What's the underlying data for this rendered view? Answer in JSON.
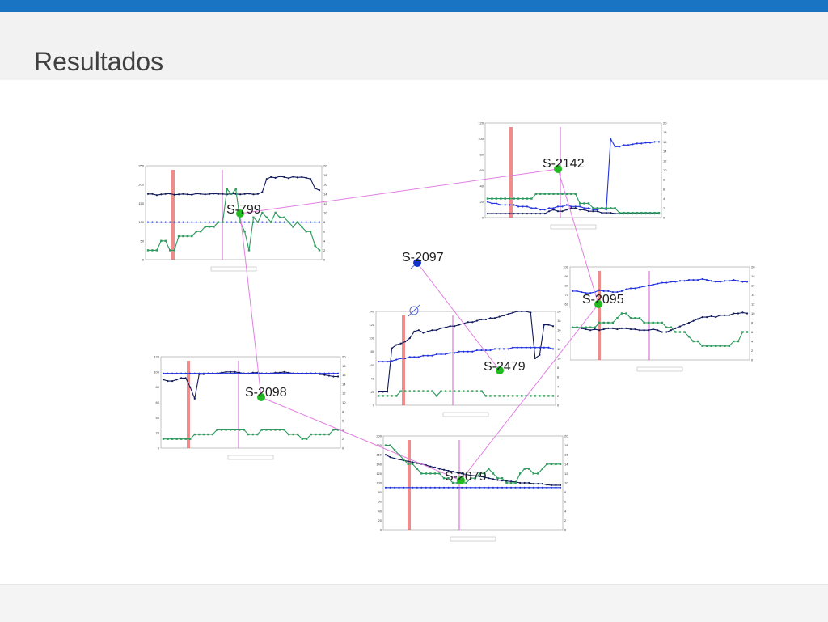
{
  "slide": {
    "title": "Resultados"
  },
  "colors": {
    "accent_bar": "#1a74c4",
    "oil": "#101a5a",
    "water_pct": "#2233dd",
    "pressure": "#2e9a5e",
    "event_red": "#e23030",
    "event_pink": "#d86ad8",
    "link": "#e27ee2",
    "producer": "#22bb22",
    "injector": "#1133cc"
  },
  "wells": [
    {
      "name": "S-799",
      "kind": "producer"
    },
    {
      "name": "S-2142",
      "kind": "producer"
    },
    {
      "name": "S-2097",
      "kind": "injector"
    },
    {
      "name": "S-2095",
      "kind": "producer"
    },
    {
      "name": "S-2479",
      "kind": "producer"
    },
    {
      "name": "S-2098",
      "kind": "producer"
    },
    {
      "name": "S-2079",
      "kind": "producer"
    }
  ],
  "links": [
    [
      "S-799",
      "S-2142"
    ],
    [
      "S-2142",
      "S-2095"
    ],
    [
      "S-799",
      "S-2098"
    ],
    [
      "S-2098",
      "S-2079"
    ],
    [
      "S-2079",
      "S-2095"
    ],
    [
      "S-2097",
      "S-2479"
    ]
  ],
  "chart_data": [
    {
      "type": "line",
      "well": "S-799",
      "ylim": [
        0,
        250
      ],
      "y2lim": [
        0,
        20
      ],
      "yticks": [
        "250",
        "200",
        "150",
        "100",
        "50",
        "0"
      ],
      "y2ticks": [
        "20",
        "18",
        "16",
        "14",
        "12",
        "10",
        "8",
        "6",
        "4",
        "2",
        "0"
      ],
      "series": [
        {
          "axis": "left",
          "color": "oil",
          "values": [
            175,
            175,
            172,
            174,
            175,
            176,
            173,
            174,
            175,
            174,
            173,
            176,
            175,
            174,
            175,
            176,
            175,
            175,
            174,
            176,
            175,
            174,
            175,
            176,
            174,
            175,
            180,
            215,
            220,
            218,
            222,
            220,
            217,
            221,
            219,
            220,
            218,
            215,
            190,
            185
          ]
        },
        {
          "axis": "left",
          "color": "water_pct",
          "values": [
            100,
            100,
            100,
            100,
            100,
            100,
            100,
            100,
            100,
            100,
            100,
            100,
            100,
            100,
            100,
            100,
            100,
            100,
            100,
            100,
            100,
            100,
            100,
            100,
            100,
            100,
            100,
            100,
            100,
            100,
            100,
            100,
            100,
            100,
            100,
            100,
            100,
            100,
            100,
            100
          ]
        },
        {
          "axis": "right",
          "color": "pressure",
          "values": [
            2,
            2,
            2,
            4,
            4,
            2,
            2,
            5,
            5,
            5,
            5,
            6,
            6,
            7,
            7,
            7,
            8,
            8,
            15,
            14,
            15,
            8,
            6,
            2,
            9,
            8,
            10,
            9,
            8,
            10,
            9,
            9,
            8,
            7,
            8,
            7,
            6,
            6,
            3,
            2
          ]
        }
      ]
    },
    {
      "type": "line",
      "well": "S-2142",
      "ylim": [
        0,
        120
      ],
      "y2lim": [
        0,
        20
      ],
      "yticks": [
        "120",
        "100",
        "80",
        "60",
        "40",
        "20",
        "0"
      ],
      "y2ticks": [
        "20",
        "18",
        "16",
        "14",
        "12",
        "10",
        "8",
        "6",
        "4",
        "2",
        "0"
      ],
      "series": [
        {
          "axis": "left",
          "color": "oil",
          "values": [
            5,
            5,
            5,
            5,
            5,
            5,
            5,
            5,
            5,
            5,
            5,
            5,
            5,
            5,
            8,
            10,
            8,
            8,
            10,
            12,
            12,
            10,
            10,
            8,
            8,
            8,
            6,
            6,
            6,
            5,
            5,
            5,
            5,
            5,
            5,
            5,
            5,
            5,
            5,
            5
          ]
        },
        {
          "axis": "left",
          "color": "water_pct",
          "values": [
            20,
            18,
            18,
            16,
            16,
            16,
            16,
            14,
            14,
            14,
            12,
            12,
            10,
            10,
            12,
            12,
            14,
            14,
            16,
            14,
            14,
            14,
            12,
            12,
            10,
            10,
            12,
            10,
            100,
            90,
            90,
            92,
            92,
            93,
            94,
            94,
            95,
            95,
            96,
            96
          ]
        },
        {
          "axis": "right",
          "color": "pressure",
          "values": [
            4,
            4,
            4,
            4,
            4,
            4,
            4,
            4,
            4,
            4,
            4,
            5,
            5,
            5,
            5,
            5,
            5,
            5,
            5,
            5,
            5,
            3,
            3,
            3,
            2,
            2,
            2,
            2,
            2,
            2,
            1,
            1,
            1,
            1,
            1,
            1,
            1,
            1,
            1,
            1
          ]
        }
      ]
    },
    {
      "type": "line",
      "well": "S-2095",
      "ylim": [
        0,
        100
      ],
      "y2lim": [
        0,
        20
      ],
      "yticks": [
        "100",
        "90",
        "80",
        "70",
        "60",
        "50",
        "40",
        "30",
        "20",
        "10",
        "0"
      ],
      "y2ticks": [
        "20",
        "18",
        "16",
        "14",
        "12",
        "10",
        "8",
        "6",
        "4",
        "2",
        "0"
      ],
      "series": [
        {
          "axis": "left",
          "color": "oil",
          "values": [
            35,
            35,
            34,
            33,
            32,
            33,
            32,
            33,
            34,
            34,
            33,
            34,
            34,
            33,
            33,
            32,
            32,
            32,
            33,
            32,
            30,
            30,
            32,
            34,
            36,
            38,
            40,
            42,
            44,
            46,
            46,
            47,
            46,
            48,
            48,
            48,
            50,
            50,
            51,
            50
          ]
        },
        {
          "axis": "left",
          "color": "water_pct",
          "values": [
            74,
            74,
            73,
            72,
            72,
            73,
            75,
            74,
            74,
            73,
            73,
            74,
            76,
            77,
            77,
            78,
            79,
            80,
            81,
            82,
            83,
            83,
            84,
            84,
            85,
            85,
            86,
            86,
            86,
            87,
            86,
            85,
            84,
            84,
            85,
            85,
            86,
            85,
            84,
            84
          ]
        },
        {
          "axis": "right",
          "color": "pressure",
          "values": [
            7,
            7,
            7,
            7,
            7,
            7,
            8,
            8,
            8,
            8,
            9,
            10,
            10,
            9,
            9,
            9,
            8,
            8,
            8,
            8,
            8,
            7,
            7,
            6,
            6,
            6,
            5,
            4,
            4,
            3,
            3,
            3,
            3,
            3,
            3,
            3,
            4,
            4,
            6,
            6
          ]
        }
      ]
    },
    {
      "type": "line",
      "well": "S-2479",
      "ylim": [
        0,
        140
      ],
      "y2lim": [
        0,
        20
      ],
      "yticks": [
        "140",
        "120",
        "100",
        "80",
        "60",
        "40",
        "20",
        "0"
      ],
      "y2ticks": [
        "20",
        "18",
        "16",
        "14",
        "12",
        "10",
        "8",
        "6",
        "4",
        "2",
        "0"
      ],
      "series": [
        {
          "axis": "left",
          "color": "oil",
          "values": [
            20,
            20,
            20,
            85,
            90,
            92,
            95,
            100,
            110,
            112,
            108,
            110,
            112,
            112,
            115,
            116,
            118,
            118,
            120,
            122,
            124,
            124,
            126,
            128,
            128,
            130,
            130,
            132,
            134,
            136,
            138,
            140,
            140,
            140,
            138,
            70,
            75,
            120,
            120,
            118
          ]
        },
        {
          "axis": "left",
          "color": "water_pct",
          "values": [
            65,
            65,
            65,
            66,
            68,
            70,
            70,
            72,
            72,
            72,
            74,
            74,
            74,
            76,
            76,
            76,
            78,
            78,
            80,
            80,
            80,
            80,
            82,
            82,
            82,
            82,
            84,
            84,
            84,
            84,
            86,
            86,
            86,
            86,
            86,
            86,
            86,
            86,
            86,
            84
          ]
        },
        {
          "axis": "right",
          "color": "pressure",
          "values": [
            2,
            2,
            2,
            2,
            2,
            3,
            3,
            3,
            3,
            3,
            3,
            3,
            3,
            2,
            3,
            3,
            3,
            3,
            3,
            3,
            3,
            3,
            3,
            3,
            2,
            2,
            2,
            2,
            2,
            2,
            2,
            2,
            2,
            2,
            2,
            2,
            2,
            2,
            2,
            2
          ]
        }
      ]
    },
    {
      "type": "line",
      "well": "S-2098",
      "ylim": [
        0,
        120
      ],
      "y2lim": [
        0,
        20
      ],
      "yticks": [
        "120",
        "100",
        "80",
        "60",
        "40",
        "20",
        "0"
      ],
      "y2ticks": [
        "20",
        "18",
        "16",
        "14",
        "12",
        "10",
        "8",
        "6",
        "4",
        "2",
        "0"
      ],
      "series": [
        {
          "axis": "left",
          "color": "oil",
          "values": [
            90,
            88,
            88,
            90,
            92,
            92,
            80,
            65,
            97,
            97,
            98,
            98,
            98,
            99,
            100,
            100,
            100,
            99,
            98,
            98,
            99,
            99,
            98,
            98,
            98,
            99,
            99,
            100,
            99,
            98,
            98,
            98,
            98,
            98,
            98,
            97,
            96,
            95,
            94,
            94
          ]
        },
        {
          "axis": "left",
          "color": "water_pct",
          "values": [
            98,
            98,
            98,
            98,
            98,
            98,
            98,
            98,
            98,
            98,
            98,
            98,
            98,
            98,
            98,
            98,
            98,
            98,
            98,
            98,
            98,
            98,
            98,
            98,
            98,
            98,
            98,
            98,
            98,
            98,
            98,
            98,
            98,
            98,
            98,
            98,
            98,
            98,
            98,
            98
          ]
        },
        {
          "axis": "right",
          "color": "pressure",
          "values": [
            2,
            2,
            2,
            2,
            2,
            2,
            2,
            3,
            3,
            3,
            3,
            3,
            4,
            4,
            4,
            4,
            4,
            4,
            4,
            3,
            3,
            3,
            4,
            4,
            4,
            4,
            4,
            4,
            3,
            3,
            3,
            2,
            2,
            3,
            3,
            3,
            3,
            3,
            4,
            4
          ]
        }
      ]
    },
    {
      "type": "line",
      "well": "S-2079",
      "ylim": [
        0,
        200
      ],
      "y2lim": [
        0,
        20
      ],
      "yticks": [
        "200",
        "180",
        "160",
        "140",
        "120",
        "100",
        "80",
        "60",
        "40",
        "20",
        "0"
      ],
      "y2ticks": [
        "20",
        "18",
        "16",
        "14",
        "12",
        "10",
        "8",
        "6",
        "4",
        "2",
        "0"
      ],
      "series": [
        {
          "axis": "left",
          "color": "oil",
          "values": [
            160,
            155,
            152,
            150,
            148,
            146,
            144,
            142,
            140,
            138,
            135,
            133,
            130,
            128,
            126,
            124,
            122,
            120,
            118,
            116,
            115,
            114,
            112,
            110,
            108,
            106,
            105,
            104,
            103,
            102,
            100,
            100,
            100,
            98,
            98,
            98,
            96,
            95,
            95,
            95
          ]
        },
        {
          "axis": "left",
          "color": "water_pct",
          "values": [
            90,
            90,
            90,
            90,
            90,
            90,
            90,
            90,
            90,
            90,
            90,
            90,
            90,
            90,
            90,
            90,
            90,
            90,
            90,
            90,
            90,
            90,
            90,
            90,
            90,
            90,
            90,
            90,
            90,
            90,
            90,
            90,
            90,
            90,
            90,
            90,
            90,
            90,
            90,
            90
          ]
        },
        {
          "axis": "right",
          "color": "pressure",
          "values": [
            18,
            18,
            17,
            16,
            15,
            14,
            14,
            13,
            12,
            12,
            12,
            12,
            12,
            11,
            11,
            10,
            10,
            10,
            10,
            11,
            11,
            12,
            12,
            13,
            12,
            11,
            11,
            10,
            10,
            10,
            12,
            13,
            13,
            12,
            12,
            13,
            14,
            14,
            14,
            14
          ]
        }
      ]
    }
  ]
}
